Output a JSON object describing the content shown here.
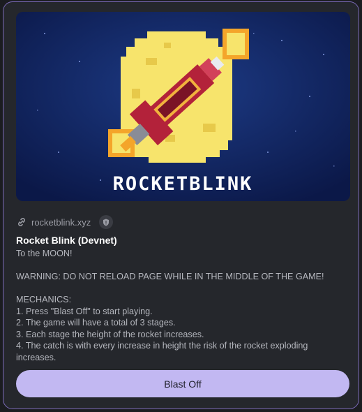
{
  "banner": {
    "wordmark": "ROCKETBLINK",
    "colors": {
      "sky": "#10205a",
      "moon": "#f7e46c",
      "rocket": "#b3223a",
      "flame": "#f4a52a"
    }
  },
  "link": {
    "icon": "link-icon",
    "url": "rocketblink.xyz",
    "badge_icon": "shield-icon"
  },
  "title": "Rocket Blink (Devnet)",
  "description": [
    "To the MOON!",
    "",
    "WARNING: DO NOT RELOAD PAGE WHILE IN THE MIDDLE OF THE GAME!",
    "",
    "MECHANICS:",
    "1. Press \"Blast Off\" to start playing.",
    "2. The game will have a total of 3 stages.",
    "3. Each stage the height of the rocket increases.",
    "4. The catch is with every increase in height the risk of the rocket exploding increases."
  ],
  "button": {
    "label": "Blast Off",
    "color": "#c2b8f2"
  }
}
